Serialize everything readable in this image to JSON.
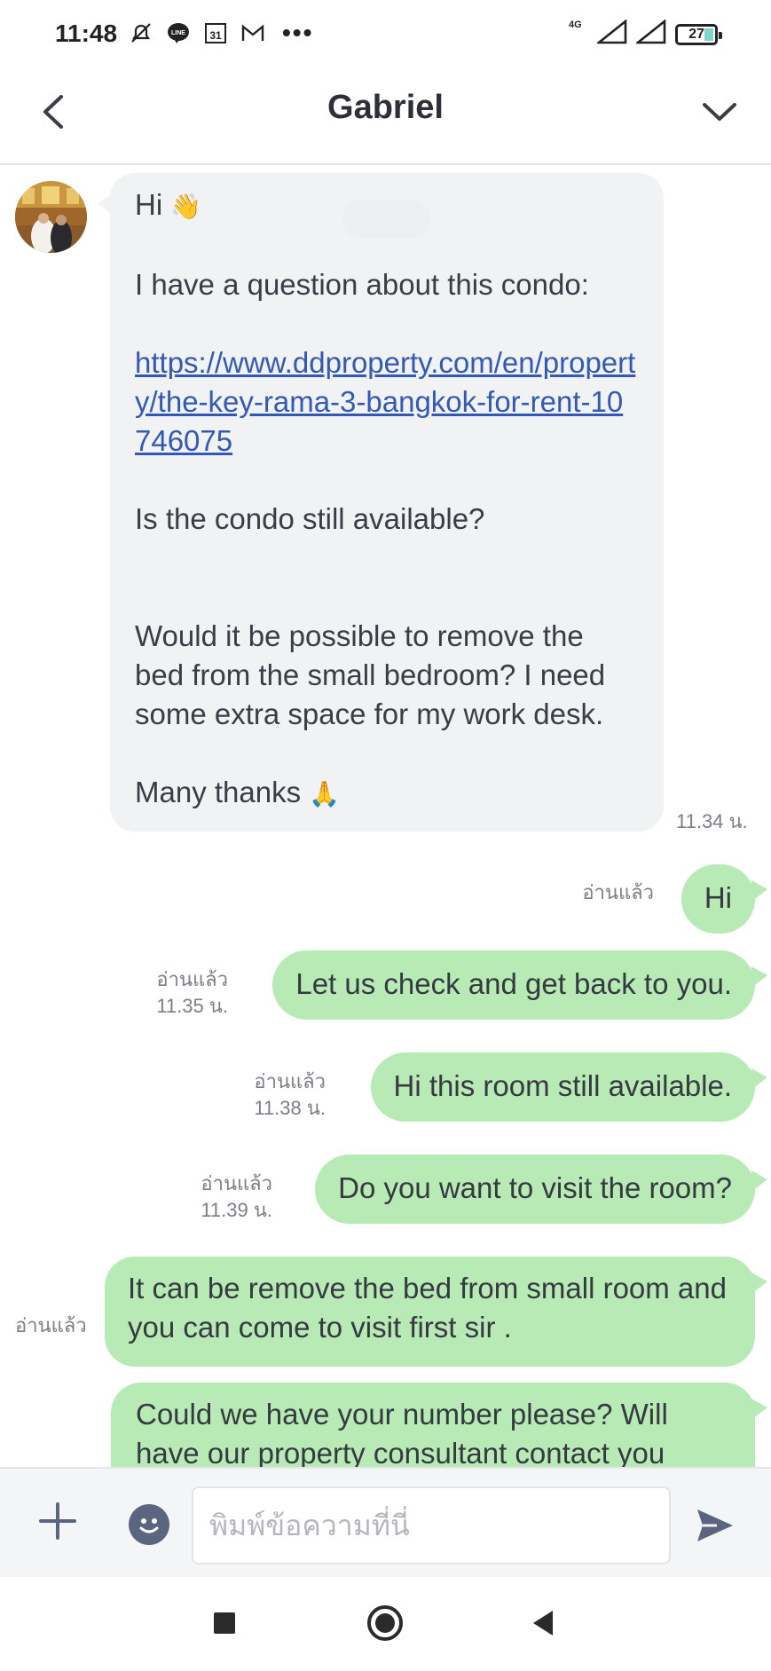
{
  "status_bar": {
    "time": "11:48",
    "network": "4G",
    "battery": "27"
  },
  "header": {
    "title": "Gabriel"
  },
  "incoming": {
    "greeting": "Hi",
    "wave_emoji": "👋",
    "question_line": "I have a question about this condo:",
    "link": "https://www.ddproperty.com/en/property/the-key-rama-3-bangkok-for-rent-10746075",
    "available_line": "Is the condo still available?",
    "request_line": "Would it be possible to remove the bed from the small bedroom? I need some extra space for my work desk.",
    "thanks_line": "Many thanks",
    "thanks_emoji": "🙏",
    "time": "11.34 น."
  },
  "outgoing": [
    {
      "text": "Hi",
      "read": "อ่านแล้ว",
      "time": ""
    },
    {
      "text": "Let us check and get back to you.",
      "read": "อ่านแล้ว",
      "time": "11.35 น."
    },
    {
      "text": "Hi this room still available.",
      "read": "อ่านแล้ว",
      "time": "11.38 น."
    },
    {
      "text": "Do you want to visit the room?",
      "read": "อ่านแล้ว",
      "time": "11.39 น."
    },
    {
      "text": "It can be  remove the bed from small room and you can come to visit first sir .",
      "read": "อ่านแล้ว",
      "time": ""
    },
    {
      "text": "Could we have your number please? Will have our property consultant contact you",
      "read": "",
      "time": ""
    }
  ],
  "input": {
    "placeholder": "พิมพ์ข้อความที่นี่"
  },
  "colors": {
    "outgoing_bubble": "#b7eab4",
    "incoming_bubble": "#f1f2f4",
    "link": "#3358b5",
    "accent_icon": "#5b6580"
  },
  "icons": [
    "back-icon",
    "chevron-down-icon",
    "plus-icon",
    "sticker-icon",
    "send-icon",
    "nav-recent-icon",
    "nav-home-icon",
    "nav-back-icon"
  ]
}
